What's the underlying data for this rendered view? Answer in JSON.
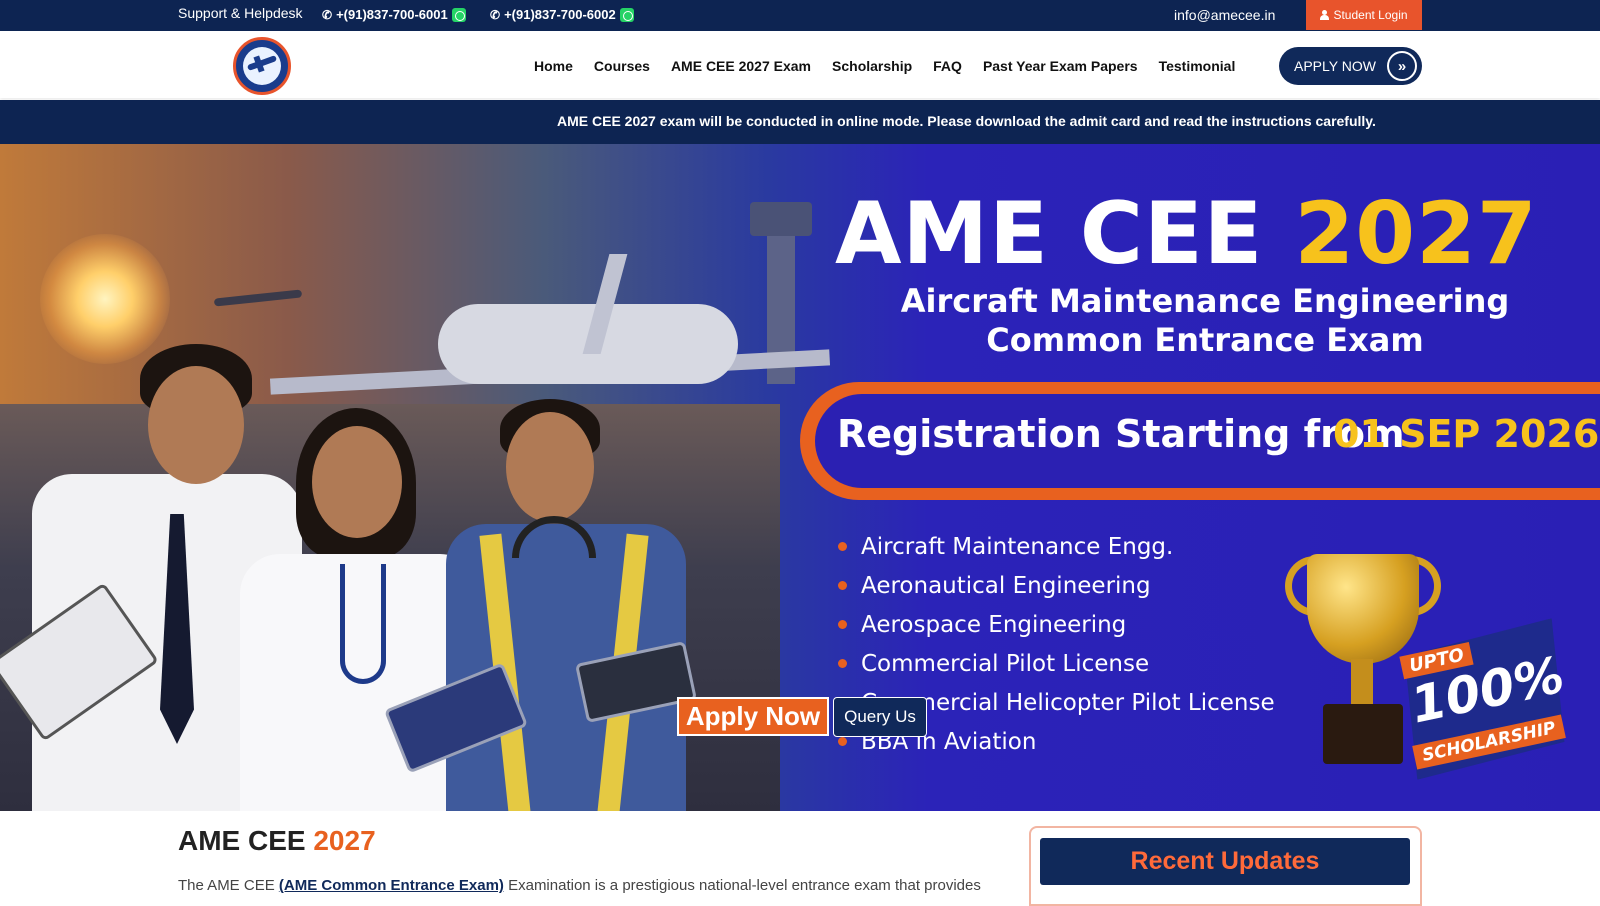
{
  "topbar": {
    "support_label": "Support & Helpdesk",
    "phone_1": "+(91)837-700-6001",
    "phone_2": "+(91)837-700-6002",
    "email": "info@amecee.in",
    "student_login": "Student Login"
  },
  "nav": {
    "items": [
      "Home",
      "Courses",
      "AME CEE 2027 Exam",
      "Scholarship",
      "FAQ",
      "Past Year Exam Papers",
      "Testimonial"
    ],
    "apply_label": "APPLY NOW"
  },
  "notice": {
    "text": "AME CEE 2027 exam will be conducted in online mode. Please download the admit card and read the instructions carefully."
  },
  "hero": {
    "title_main": "AME CEE",
    "title_year": "2027",
    "subtitle_1": "Aircraft Maintenance Engineering",
    "subtitle_2": "Common Entrance Exam",
    "registration_label": "Registration Starting from",
    "registration_date": "01 SEP 2026",
    "courses": [
      "Aircraft Maintenance Engg.",
      "Aeronautical Engineering",
      "Aerospace Engineering",
      "Commercial Pilot License",
      "Commercial Helicopter Pilot License",
      "BBA in Aviation"
    ],
    "scholarship_upto": "UPTO",
    "scholarship_percent": "100%",
    "scholarship_word": "SCHOLARSHIP",
    "apply_now": "Apply Now",
    "query_us": "Query Us"
  },
  "content": {
    "title_main": "AME CEE",
    "title_year": "2027",
    "para_prefix": "The AME CEE",
    "para_link": "(AME Common Entrance Exam)",
    "para_suffix": "Examination is a prestigious national-level entrance exam that provides"
  },
  "sidebar": {
    "recent_updates": "Recent Updates"
  },
  "colors": {
    "navy": "#0d2452",
    "accent_orange": "#e8611f",
    "accent_yellow": "#f7c21c",
    "hero_blue": "#2b20b2"
  }
}
